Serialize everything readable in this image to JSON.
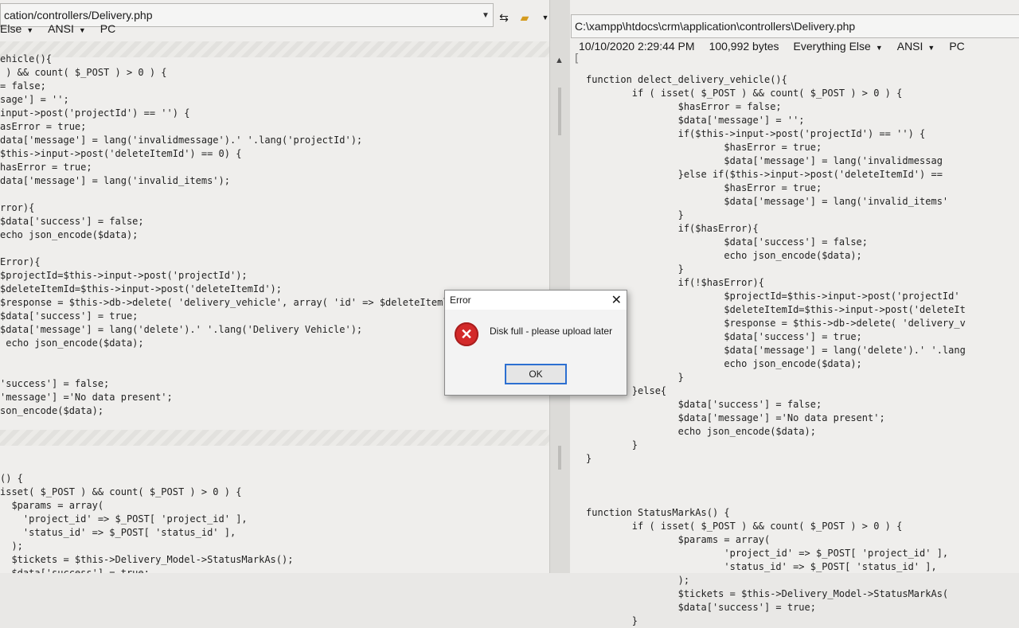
{
  "left": {
    "path": "cation/controllers/Delivery.php",
    "info": [
      "Else",
      "ANSI",
      "PC"
    ],
    "code": "ehicle(){\n ) && count( $_POST ) > 0 ) {\n= false;\nsage'] = '';\ninput->post('projectId') == '') {\nasError = true;\ndata['message'] = lang('invalidmessage').' '.lang('projectId');\n$this->input->post('deleteItemId') == 0) {\nhasError = true;\ndata['message'] = lang('invalid_items');\n\nrror){\n$data['success'] = false;\necho json_encode($data);\n\nError){\n$projectId=$this->input->post('projectId');\n$deleteItemId=$this->input->post('deleteItemId');\n$response = $this->db->delete( 'delivery_vehicle', array( 'id' => $deleteIteml\n$data['success'] = true;\n$data['message'] = lang('delete').' '.lang('Delivery Vehicle');\n echo json_encode($data);\n\n\n'success'] = false;\n'message'] ='No data present';\nson_encode($data);\n\n\n\n\n() {\nisset( $_POST ) && count( $_POST ) > 0 ) {\n  $params = array(\n    'project_id' => $_POST[ 'project_id' ],\n    'status_id' => $_POST[ 'status_id' ],\n  );\n  $tickets = $this->Delivery_Model->StatusMarkAs();\n  $data['success'] = true;\n\n\nncode($data);"
  },
  "right": {
    "path": "C:\\xampp\\htdocs\\crm\\application\\controllers\\Delivery.php",
    "info": [
      "10/10/2020 2:29:44 PM",
      "100,992 bytes",
      "Everything Else",
      "ANSI",
      "PC"
    ],
    "gutter_mark": "[",
    "code": "function delect_delivery_vehicle(){\n        if ( isset( $_POST ) && count( $_POST ) > 0 ) {\n                $hasError = false;\n                $data['message'] = '';\n                if($this->input->post('projectId') == '') {\n                        $hasError = true;\n                        $data['message'] = lang('invalidmessag\n                }else if($this->input->post('deleteItemId') ==\n                        $hasError = true;\n                        $data['message'] = lang('invalid_items'\n                }\n                if($hasError){\n                        $data['success'] = false;\n                        echo json_encode($data);\n                }\n                if(!$hasError){\n                        $projectId=$this->input->post('projectId'\n                        $deleteItemId=$this->input->post('deleteIt\n                        $response = $this->db->delete( 'delivery_v\n                        $data['success'] = true;\n                        $data['message'] = lang('delete').' '.lang\n                        echo json_encode($data);\n                }\n        }else{\n                $data['success'] = false;\n                $data['message'] ='No data present';\n                echo json_encode($data);\n        }\n}\n\n\n\nfunction StatusMarkAs() {\n        if ( isset( $_POST ) && count( $_POST ) > 0 ) {\n                $params = array(\n                        'project_id' => $_POST[ 'project_id' ],\n                        'status_id' => $_POST[ 'status_id' ],\n                );\n                $tickets = $this->Delivery_Model->StatusMarkAs(\n                $data['success'] = true;\n        }"
  },
  "dialog": {
    "title": "Error",
    "message": "Disk full - please upload later",
    "ok_label": "OK",
    "close_glyph": "✕",
    "icon_glyph": "✕"
  }
}
